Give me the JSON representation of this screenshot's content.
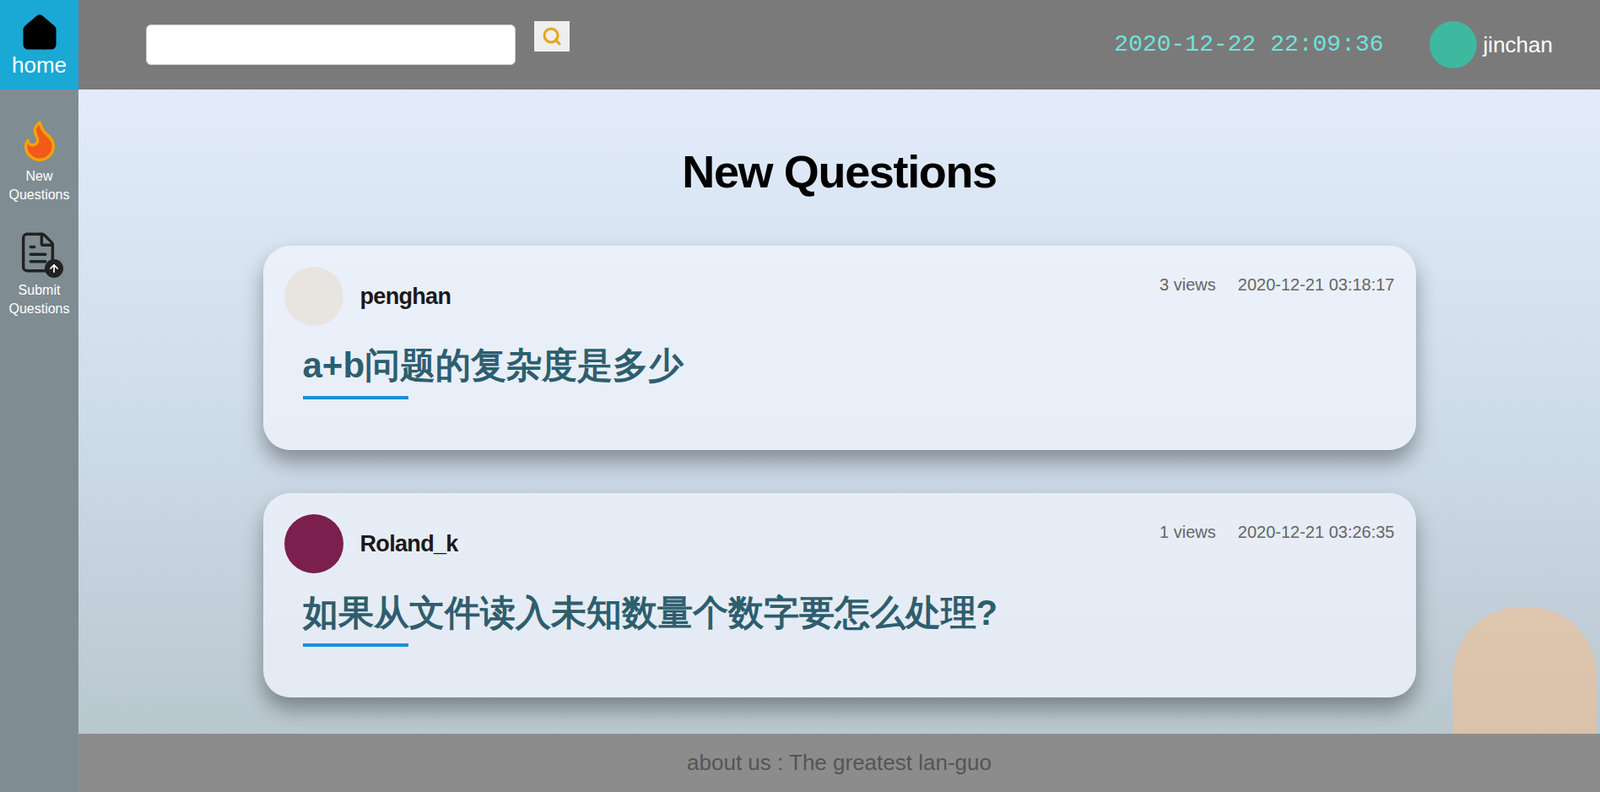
{
  "sidebar": {
    "home": "home",
    "items": [
      {
        "label": "New Questions",
        "kind": "new"
      },
      {
        "label": "Submit Questions",
        "kind": "submit"
      }
    ]
  },
  "search": {
    "value": "",
    "placeholder": ""
  },
  "clock": "2020-12-22 22:09:36",
  "user": {
    "name": "jinchan"
  },
  "page_title": "New Questions",
  "questions": [
    {
      "author": "penghan",
      "views": "3 views",
      "date": "2020-12-21 03:18:17",
      "title": "a+b问题的复杂度是多少"
    },
    {
      "author": "Roland_k",
      "views": "1 views",
      "date": "2020-12-21 03:26:35",
      "title": "如果从文件读入未知数量个数字要怎么处理?"
    }
  ],
  "footer": "about us : The greatest lan-guo"
}
